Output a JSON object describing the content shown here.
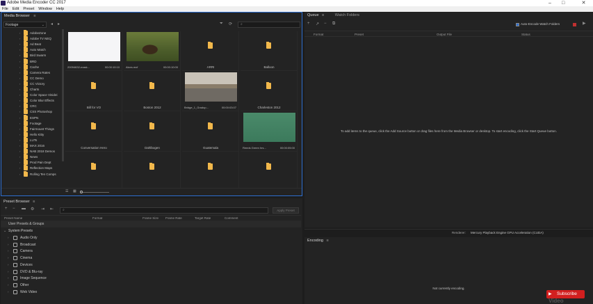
{
  "app": {
    "title": "Adobe Media Encoder CC 2017",
    "menu": [
      "File",
      "Edit",
      "Preset",
      "Window",
      "Help"
    ]
  },
  "media_browser": {
    "tab_label": "Media Browser",
    "location": "Footage",
    "tree": [
      "AdobeZone",
      "Adobe TV NEQ",
      "Ad Beat",
      "Auto Match",
      "Bird Swarm",
      "BRD",
      "Cache",
      "Camera Rates",
      "CC Demo",
      "CC Victory",
      "Charts",
      "Color Space Vinidei",
      "Color Blur Effects",
      "CRC",
      "CSS Photoshop",
      "ESPN",
      "Footage",
      "Fairmount Things",
      "Hello Kitty",
      "LUTs",
      "MAX 2016",
      "NAB 2018 Demos",
      "News",
      "Prod Pain Dept",
      "Reflection Maps",
      "Rolling Ten Comps"
    ],
    "items": [
      {
        "name": "20094632-mask...",
        "duration": "00:00:10:10",
        "kind": "video-white"
      },
      {
        "name": "Alces.mxf",
        "duration": "00:00:10:00",
        "kind": "video-moose"
      },
      {
        "name": "ARRI",
        "kind": "folder"
      },
      {
        "name": "Balloon",
        "kind": "folder"
      },
      {
        "name": "Bill for VO",
        "kind": "folder"
      },
      {
        "name": "Boston 2012",
        "kind": "folder"
      },
      {
        "name": "Bridge_1_Gradup...",
        "duration": "00:00:03:07",
        "kind": "video-bridge"
      },
      {
        "name": "Charleston 2012",
        "kind": "folder"
      },
      {
        "name": "Conversation Hero",
        "kind": "folder"
      },
      {
        "name": "Dahlbogen",
        "kind": "folder"
      },
      {
        "name": "Guatemala",
        "kind": "folder"
      },
      {
        "name": "Reeds Green hrs...",
        "duration": "00:00:05:00",
        "kind": "video-green"
      },
      {
        "name": "",
        "kind": "folder"
      },
      {
        "name": "",
        "kind": "folder"
      },
      {
        "name": "",
        "kind": "folder"
      },
      {
        "name": "",
        "kind": "folder"
      }
    ]
  },
  "queue": {
    "tab_label": "Queue",
    "tab2_label": "Watch Folders",
    "auto_encode_label": "Auto-Encode Watch Folders",
    "columns": [
      "Format",
      "Preset",
      "Output File",
      "Status"
    ],
    "empty_message": "To add items to the queue, click the Add Source button or drag files here from the Media Browser or desktop.  To start encoding, click the Start Queue button.",
    "renderer_label": "Renderer:",
    "renderer_value": "Mercury Playback Engine GPU Acceleration (CUDA)"
  },
  "preset_browser": {
    "tab_label": "Preset Browser",
    "apply_label": "Apply Preset",
    "columns": [
      "Preset Name",
      "Format",
      "Frame Size",
      "Frame Rate",
      "Target Rate",
      "Comment"
    ],
    "user_presets": "User Presets & Groups",
    "system_presets": "System Presets",
    "groups": [
      "Audio Only",
      "Broadcast",
      "Camera",
      "Cinema",
      "Devices",
      "DVD & Blu-ray",
      "Image Sequence",
      "Other",
      "Web Video"
    ]
  },
  "encoding": {
    "tab_label": "Encoding",
    "status": "Not currently encoding."
  },
  "overlay": {
    "subscribe_label": "Subscribe",
    "watermark": "Video"
  },
  "colors": {
    "accent": "#2d6fd2",
    "folder": "#f2b84b",
    "subscribe": "#d21f1f"
  }
}
